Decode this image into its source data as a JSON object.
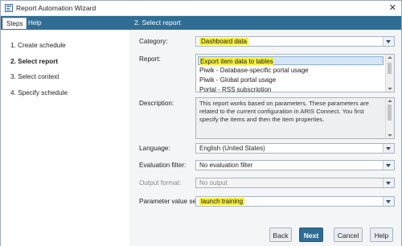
{
  "window": {
    "title": "Report Automation Wizard",
    "close_glyph": "✕"
  },
  "tabs": [
    {
      "label": "Steps"
    },
    {
      "label": "Help"
    }
  ],
  "steps": [
    {
      "label": "1. Create schedule"
    },
    {
      "label": "2. Select report"
    },
    {
      "label": "3. Select context"
    },
    {
      "label": "4. Specify schedule"
    }
  ],
  "section": {
    "title": "2. Select report"
  },
  "fields": {
    "category": {
      "label": "Category:",
      "value": "Dashboard data"
    },
    "report": {
      "label": "Report:",
      "items": [
        "Export item data to tables",
        "Piwik - Database-specific portal usage",
        "Piwik - Global portal usage",
        "Portal - RSS subscription"
      ]
    },
    "description": {
      "label": "Description:",
      "text": "This report works based on parameters. These parameters are related to the current configuration in ARIS Connect. You first specify the items and then the item properties."
    },
    "language": {
      "label": "Language:",
      "value": "English (United States)"
    },
    "evaluation_filter": {
      "label": "Evaluation filter:",
      "value": "No evaluation filter"
    },
    "output_format": {
      "label": "Output format:",
      "value": "No output"
    },
    "parameter_value_set": {
      "label": "Parameter value set:",
      "value": "launch training"
    }
  },
  "buttons": {
    "back": "Back",
    "next": "Next",
    "cancel": "Cancel",
    "help": "Help"
  },
  "colors": {
    "header": "#2f6d95",
    "highlight": "#f6ee3c",
    "selection": "#d6e6f5"
  }
}
